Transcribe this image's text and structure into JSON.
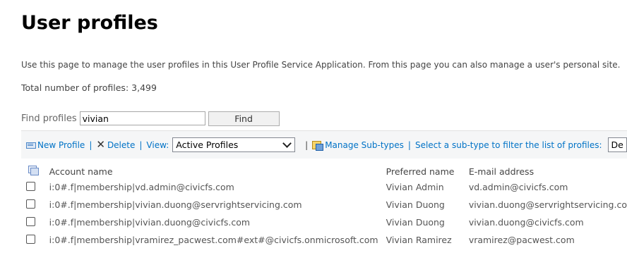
{
  "page": {
    "title": "User profiles",
    "description": "Use this page to manage the user profiles in this User Profile Service Application. From this page you can also manage a user's personal site.",
    "total_label": "Total number of profiles:",
    "total_count": "3,499"
  },
  "find": {
    "label": "Find profiles",
    "value": "vivian",
    "button_label": "Find"
  },
  "toolbar": {
    "new_profile": "New Profile",
    "delete": "Delete",
    "view_label": "View:",
    "view_selected": "Active Profiles",
    "manage_subtypes": "Manage Sub-types",
    "subtype_filter_label": "Select a sub-type to filter the list of profiles:",
    "subtype_selected": "De",
    "separator": "|",
    "icons": {
      "new": "new-profile-icon",
      "delete": "delete-x-icon",
      "manage": "manage-subtypes-icon"
    }
  },
  "table": {
    "headers": {
      "account": "Account name",
      "preferred": "Preferred name",
      "email": "E-mail address"
    },
    "rows": [
      {
        "account": "i:0#.f|membership|vd.admin@civicfs.com",
        "preferred": "Vivian Admin",
        "email": "vd.admin@civicfs.com"
      },
      {
        "account": "i:0#.f|membership|vivian.duong@servrightservicing.com",
        "preferred": "Vivian Duong",
        "email": "vivian.duong@servrightservicing.co"
      },
      {
        "account": "i:0#.f|membership|vivian.duong@civicfs.com",
        "preferred": "Vivian Duong",
        "email": "vivian.duong@civicfs.com"
      },
      {
        "account": "i:0#.f|membership|vramirez_pacwest.com#ext#@civicfs.onmicrosoft.com",
        "preferred": "Vivian Ramirez",
        "email": "vramirez@pacwest.com"
      }
    ]
  },
  "colors": {
    "link": "#0072c6",
    "toolbar_bg": "#f5f6f7",
    "text": "#444444"
  }
}
